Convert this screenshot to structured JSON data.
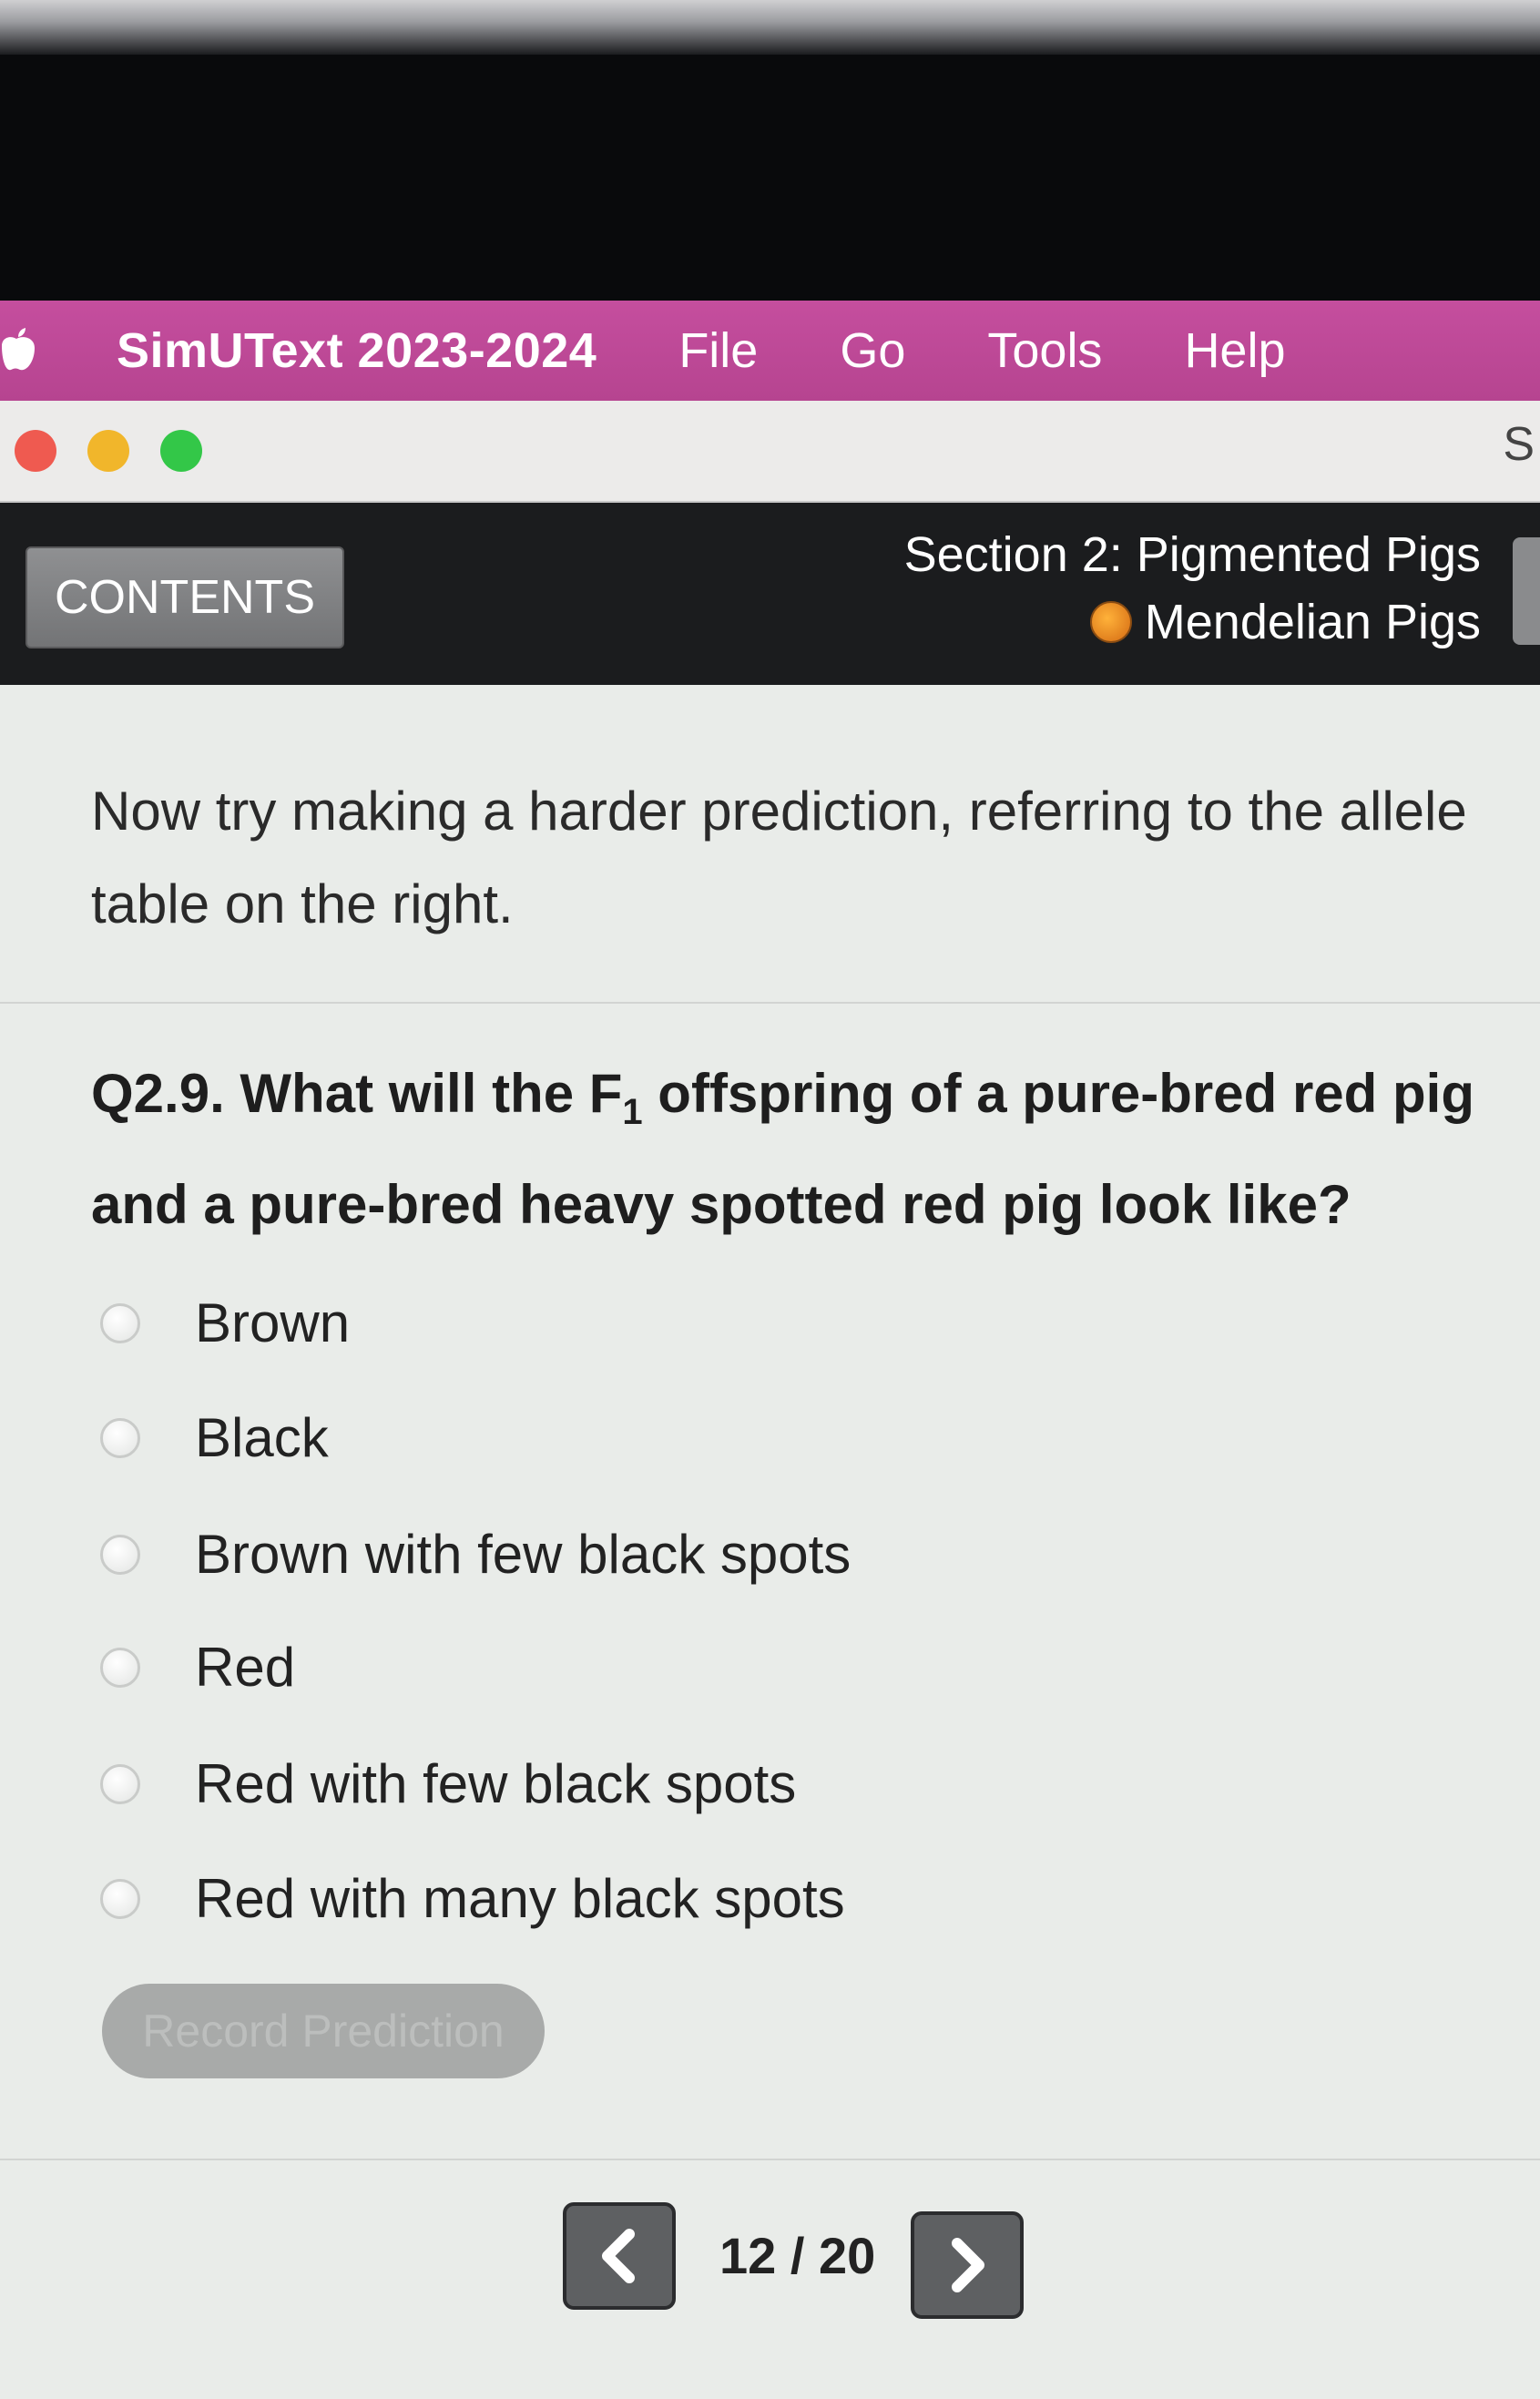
{
  "menubar": {
    "app_name": "SimUText 2023-2024",
    "items": [
      "File",
      "Go",
      "Tools",
      "Help"
    ]
  },
  "window": {
    "title_partial": "S"
  },
  "header": {
    "contents_label": "CONTENTS",
    "section_title": "Section 2: Pigmented Pigs",
    "section_sub": "Mendelian Pigs"
  },
  "main": {
    "intro": "Now try making a harder prediction, referring to the allele table on the right.",
    "question_prefix": "Q2.9. What will the F",
    "question_sub": "1",
    "question_suffix": " offspring of a pure-bred red pig and a pure-bred heavy spotted red pig look like?",
    "options": [
      "Brown",
      "Black",
      "Brown with few black spots",
      "Red",
      "Red with few black spots",
      "Red with many black spots"
    ],
    "record_button": "Record Prediction"
  },
  "pagination": {
    "current": "12 / 20"
  }
}
